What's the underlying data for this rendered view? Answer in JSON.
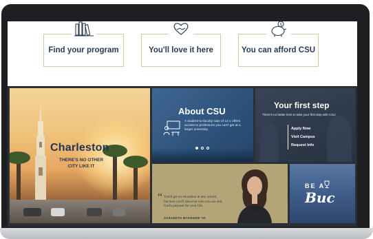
{
  "cards": [
    {
      "label": "Find your program",
      "icon": "books-icon"
    },
    {
      "label": "You'll love it here",
      "icon": "heart-hand-icon"
    },
    {
      "label": "You can afford CSU",
      "icon": "piggy-bank-icon"
    }
  ],
  "charleston": {
    "title": "Charleston",
    "subtitle_line1": "THERE'S NO OTHER",
    "subtitle_line2": "CITY LIKE IT"
  },
  "about": {
    "title": "About CSU",
    "text": "A student-to-faculty ratio of 12:1 offers access to professors you can't get at a larger university.",
    "icon": "classroom-icon",
    "slides_total": 3,
    "slide_active": 1
  },
  "first_step": {
    "title": "Your first step",
    "subtitle": "There's no better time to take your first step with CSU.",
    "links": [
      "Apply Now",
      "Visit Campus",
      "Request Info"
    ]
  },
  "quote": {
    "mark": "“",
    "text": "You'll get an education at any school, but here you'll discover who you are and God's purpose for your life.",
    "name": "SARABETH MCKENZIE '20"
  },
  "buc": {
    "line1": "BE  A",
    "line2": "Buc",
    "icon": "trophy-icon"
  },
  "colors": {
    "navy": "#2c3b52",
    "gold_border": "#d6c9a4",
    "quote_bg": "#b3a578",
    "about_bg": "#2d527b"
  }
}
